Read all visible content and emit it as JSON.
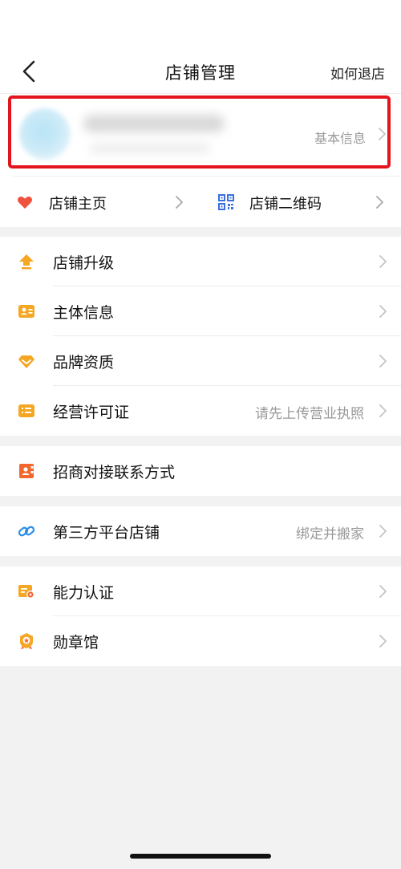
{
  "header": {
    "title": "店铺管理",
    "help_link": "如何退店"
  },
  "profile": {
    "basic_info_label": "基本信息"
  },
  "quick_links": [
    {
      "label": "店铺主页",
      "icon": "heart-icon"
    },
    {
      "label": "店铺二维码",
      "icon": "qr-code-icon"
    }
  ],
  "group1": [
    {
      "label": "店铺升级",
      "hint": "",
      "icon": "upgrade-arrow-icon"
    },
    {
      "label": "主体信息",
      "hint": "",
      "icon": "id-card-icon"
    },
    {
      "label": "品牌资质",
      "hint": "",
      "icon": "diamond-icon"
    },
    {
      "label": "经营许可证",
      "hint": "请先上传营业执照",
      "icon": "license-card-icon"
    }
  ],
  "group2": [
    {
      "label": "招商对接联系方式",
      "icon": "contact-book-icon"
    }
  ],
  "group3": [
    {
      "label": "第三方平台店铺",
      "hint": "绑定并搬家",
      "icon": "link-icon"
    }
  ],
  "group4": [
    {
      "label": "能力认证",
      "icon": "certificate-icon"
    },
    {
      "label": "勋章馆",
      "icon": "medal-icon"
    }
  ],
  "colors": {
    "highlight_border": "#e3141b",
    "accent_orange": "#f5a623",
    "heart_red": "#f0523d",
    "qr_blue": "#3b6fe0",
    "link_blue": "#2a8ee8"
  }
}
